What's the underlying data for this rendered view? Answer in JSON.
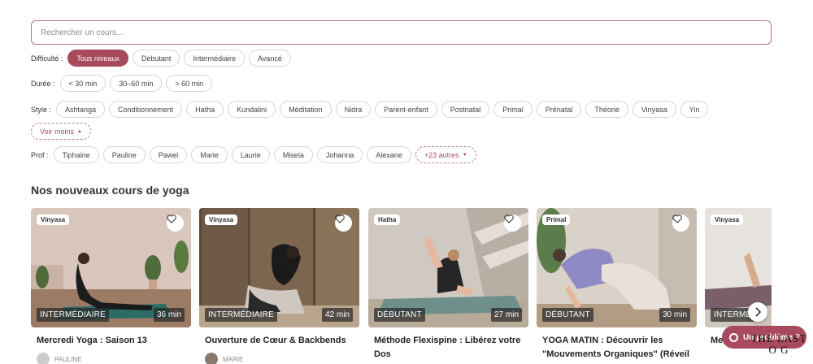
{
  "search": {
    "placeholder": "Rechercher un cours..."
  },
  "filters": {
    "difficulty": {
      "label": "Difficulté :",
      "options": [
        "Tous niveaux",
        "Débutant",
        "Intermédiaire",
        "Avancé"
      ],
      "selected": "Tous niveaux"
    },
    "duration": {
      "label": "Durée :",
      "options": [
        "< 30 min",
        "30–60 min",
        "> 60 min"
      ]
    },
    "style": {
      "label": "Style :",
      "options": [
        "Ashtanga",
        "Conditionnement",
        "Hatha",
        "Kundalini",
        "Méditation",
        "Nidra",
        "Parent-enfant",
        "Postnatal",
        "Primal",
        "Prénatal",
        "Théorie",
        "Vinyasa",
        "Yin"
      ],
      "toggle_label": "Voir moins"
    },
    "teacher": {
      "label": "Prof :",
      "options": [
        "Tiphaine",
        "Pauline",
        "Pawel",
        "Marie",
        "Laurie",
        "Misela",
        "Johanna",
        "Alexane"
      ],
      "more_label": "+23 autres"
    }
  },
  "section": {
    "title": "Nos nouveaux cours de yoga"
  },
  "cards": [
    {
      "style": "Vinyasa",
      "level": "INTERMÉDIAIRE",
      "duration": "36 min",
      "title": "Mercredi Yoga : Saison 13",
      "teacher": "PAULINE"
    },
    {
      "style": "Vinyasa",
      "level": "INTERMÉDIAIRE",
      "duration": "42 min",
      "title": "Ouverture de Cœur & Backbends",
      "teacher": "MARIE"
    },
    {
      "style": "Hatha",
      "level": "DÉBUTANT",
      "duration": "27 min",
      "title": "Méthode Flexispine : Libérez votre Dos",
      "teacher": ""
    },
    {
      "style": "Primal",
      "level": "DÉBUTANT",
      "duration": "30 min",
      "title": "YOGA MATIN : Découvrir les \"Mouvements Organiques\" (Réveil",
      "teacher": ""
    },
    {
      "style": "Vinyasa",
      "level": "INTERMÉ",
      "duration": "",
      "title": "Me pigeon royal",
      "teacher": ""
    }
  ],
  "help": {
    "problem_label": "Un problème ?"
  },
  "brand": {
    "line1": "THE LAST",
    "line2": "O G"
  }
}
